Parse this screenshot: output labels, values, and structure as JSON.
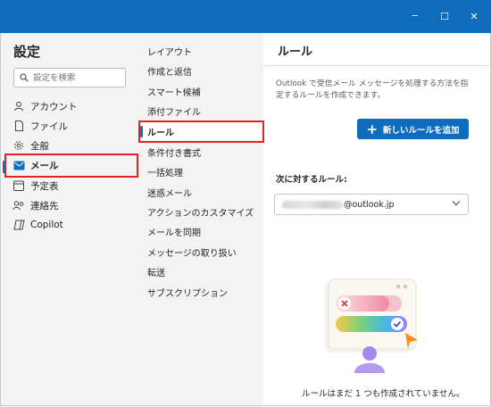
{
  "window": {
    "controls": {
      "minimize": "─",
      "maximize": "☐",
      "close": "✕"
    }
  },
  "left": {
    "title": "設定",
    "search_placeholder": "設定を検索",
    "items": [
      {
        "label": "アカウント",
        "icon": "person-icon"
      },
      {
        "label": "ファイル",
        "icon": "document-icon"
      },
      {
        "label": "全般",
        "icon": "gear-icon"
      },
      {
        "label": "メール",
        "icon": "mail-icon",
        "active": true
      },
      {
        "label": "予定表",
        "icon": "calendar-icon"
      },
      {
        "label": "連絡先",
        "icon": "people-icon"
      },
      {
        "label": "Copilot",
        "icon": "copilot-icon"
      }
    ]
  },
  "middle": {
    "items": [
      {
        "label": "レイアウト"
      },
      {
        "label": "作成と返信"
      },
      {
        "label": "スマート候補"
      },
      {
        "label": "添付ファイル"
      },
      {
        "label": "ルール",
        "active": true
      },
      {
        "label": "条件付き書式"
      },
      {
        "label": "一括処理"
      },
      {
        "label": "迷惑メール"
      },
      {
        "label": "アクションのカスタマイズ"
      },
      {
        "label": "メールを同期"
      },
      {
        "label": "メッセージの取り扱い"
      },
      {
        "label": "転送"
      },
      {
        "label": "サブスクリプション"
      }
    ]
  },
  "right": {
    "title": "ルール",
    "description": "Outlook で受信メール メッセージを処理する方法を指定するルールを作成できます。",
    "add_button": "新しいルールを追加",
    "rules_for_label": "次に対するルール:",
    "account_suffix": "@outlook.jp",
    "empty_message": "ルールはまだ 1 つも作成されていません。"
  },
  "colors": {
    "accent": "#0f6cbd",
    "highlight_box": "#e02424",
    "pane_background": "#f3f3f3"
  }
}
